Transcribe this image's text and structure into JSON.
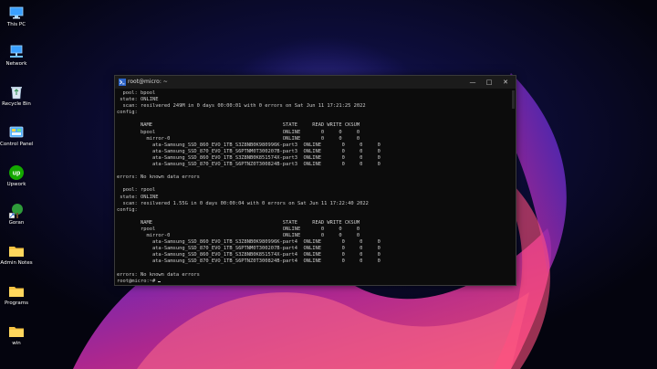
{
  "desktop": {
    "icons": [
      {
        "name": "this-pc-icon",
        "label": "This PC"
      },
      {
        "name": "network-icon",
        "label": "Network"
      },
      {
        "name": "recycle-bin-icon",
        "label": "Recycle Bin"
      },
      {
        "name": "control-panel-icon",
        "label": "Control Panel"
      },
      {
        "name": "upwork-icon",
        "label": "Upwork"
      },
      {
        "name": "goran-shortcut-icon",
        "label": "Goran"
      },
      {
        "name": "folder-icon",
        "label": "Admin Notes"
      },
      {
        "name": "folder-icon",
        "label": "Programs"
      },
      {
        "name": "folder-icon",
        "label": "win"
      }
    ]
  },
  "terminal": {
    "title": "root@micro: ~",
    "controls": {
      "minimize": "—",
      "maximize": "□",
      "close": "✕"
    },
    "lines": [
      "  pool: bpool",
      " state: ONLINE",
      "  scan: resilvered 249M in 0 days 00:00:01 with 0 errors on Sat Jun 11 17:21:25 2022",
      "config:",
      "",
      "        NAME                                            STATE     READ WRITE CKSUM",
      "        bpool                                           ONLINE       0     0     0",
      "          mirror-0                                      ONLINE       0     0     0",
      "            ata-Samsung_SSD_860_EVO_1TB_S3Z8NB0K980996K-part3  ONLINE       0     0     0",
      "            ata-Samsung_SSD_870_EVO_1TB_S6PTNM0T300207B-part3  ONLINE       0     0     0",
      "            ata-Samsung_SSD_860_EVO_1TB_S3Z8NB0K851574X-part3  ONLINE       0     0     0",
      "            ata-Samsung_SSD_870_EVO_1TB_S6PTNZ0T300824B-part3  ONLINE       0     0     0",
      "",
      "errors: No known data errors",
      "",
      "  pool: rpool",
      " state: ONLINE",
      "  scan: resilvered 1.55G in 0 days 00:00:04 with 0 errors on Sat Jun 11 17:22:40 2022",
      "config:",
      "",
      "        NAME                                            STATE     READ WRITE CKSUM",
      "        rpool                                           ONLINE       0     0     0",
      "          mirror-0                                      ONLINE       0     0     0",
      "            ata-Samsung_SSD_860_EVO_1TB_S3Z8NB0K980996K-part4  ONLINE       0     0     0",
      "            ata-Samsung_SSD_870_EVO_1TB_S6PTNM0T300207B-part4  ONLINE       0     0     0",
      "            ata-Samsung_SSD_860_EVO_1TB_S3Z8NB0K851574X-part4  ONLINE       0     0     0",
      "            ata-Samsung_SSD_870_EVO_1TB_S6PTNZ0T300824B-part4  ONLINE       0     0     0",
      "",
      "errors: No known data errors"
    ],
    "prompt": "root@micro:~# "
  }
}
